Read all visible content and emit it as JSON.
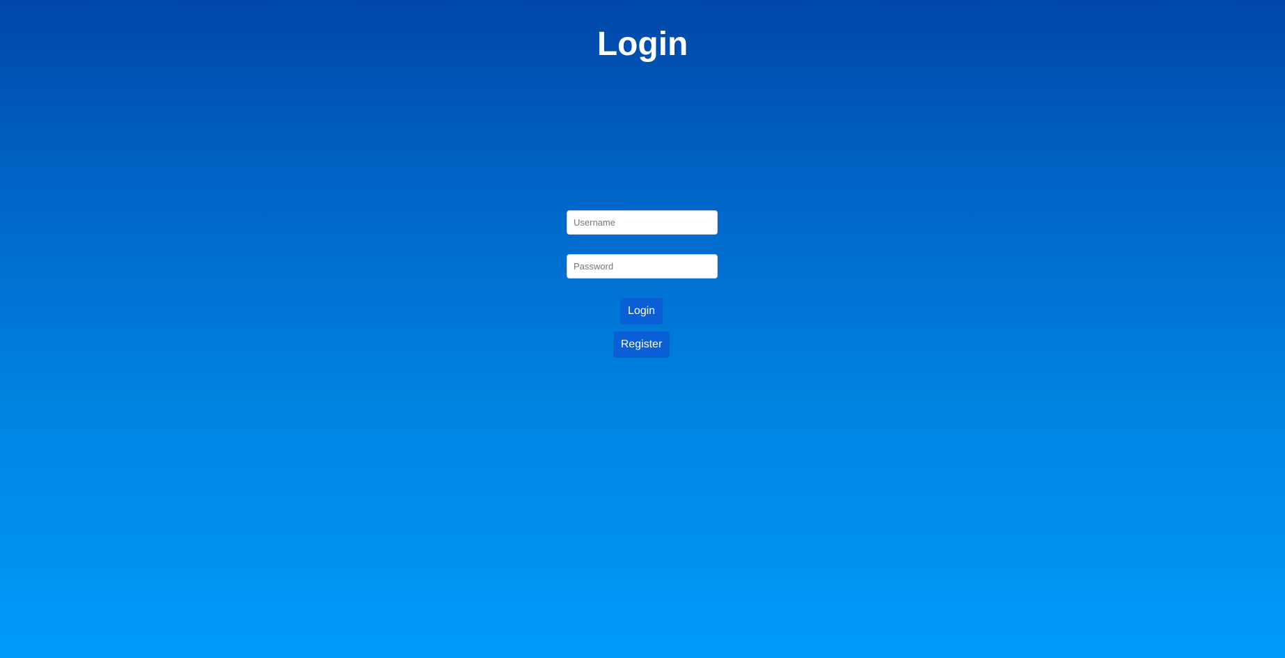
{
  "page": {
    "title": "Login"
  },
  "form": {
    "username": {
      "value": "",
      "placeholder": "Username"
    },
    "password": {
      "value": "",
      "placeholder": "Password"
    },
    "login_label": "Login",
    "register_label": "Register"
  },
  "colors": {
    "background_top": "#0047a8",
    "background_bottom": "#009bfa",
    "button": "#0a5fd6",
    "text": "#ffffff"
  }
}
